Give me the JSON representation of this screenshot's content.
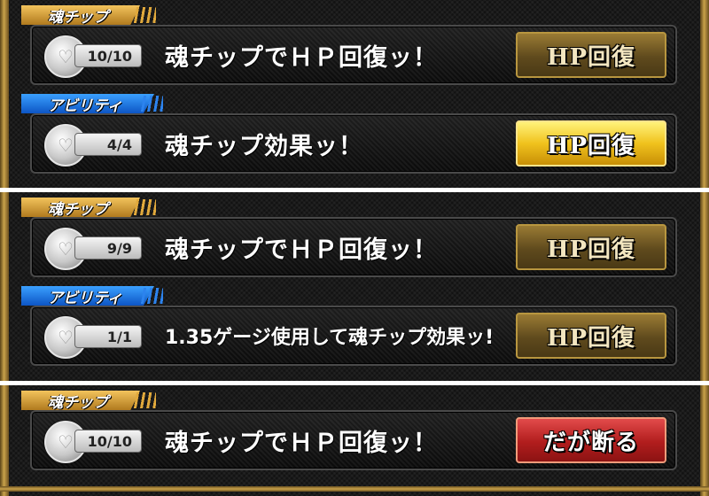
{
  "screens": [
    {
      "rows": [
        {
          "label": "魂チップ",
          "label_style": "gold",
          "count": "10/10",
          "message": "魂チップでＨＰ回復ッ！",
          "button": "HP回復",
          "button_style": "dim"
        },
        {
          "label": "アビリティ",
          "label_style": "blue",
          "count": "4/4",
          "message": "魂チップ効果ッ！",
          "button": "HP回復",
          "button_style": "gold"
        }
      ]
    },
    {
      "rows": [
        {
          "label": "魂チップ",
          "label_style": "gold",
          "count": "9/9",
          "message": "魂チップでＨＰ回復ッ！",
          "button": "HP回復",
          "button_style": "dim"
        },
        {
          "label": "アビリティ",
          "label_style": "blue",
          "count": "1/1",
          "message": "1.35ゲージ使用して魂チップ効果ッ!",
          "button": "HP回復",
          "button_style": "dim"
        }
      ]
    },
    {
      "rows": [
        {
          "label": "魂チップ",
          "label_style": "gold",
          "count": "10/10",
          "message": "魂チップでＨＰ回復ッ！",
          "button": "だが断る",
          "button_style": "red"
        }
      ]
    }
  ],
  "icons": {
    "soul_chip": "heart-coin-icon"
  },
  "colors": {
    "gold_label": "#e1a93c",
    "blue_label": "#2c83ee",
    "gold_button": "#f0c21d",
    "red_button": "#b11d1d"
  }
}
